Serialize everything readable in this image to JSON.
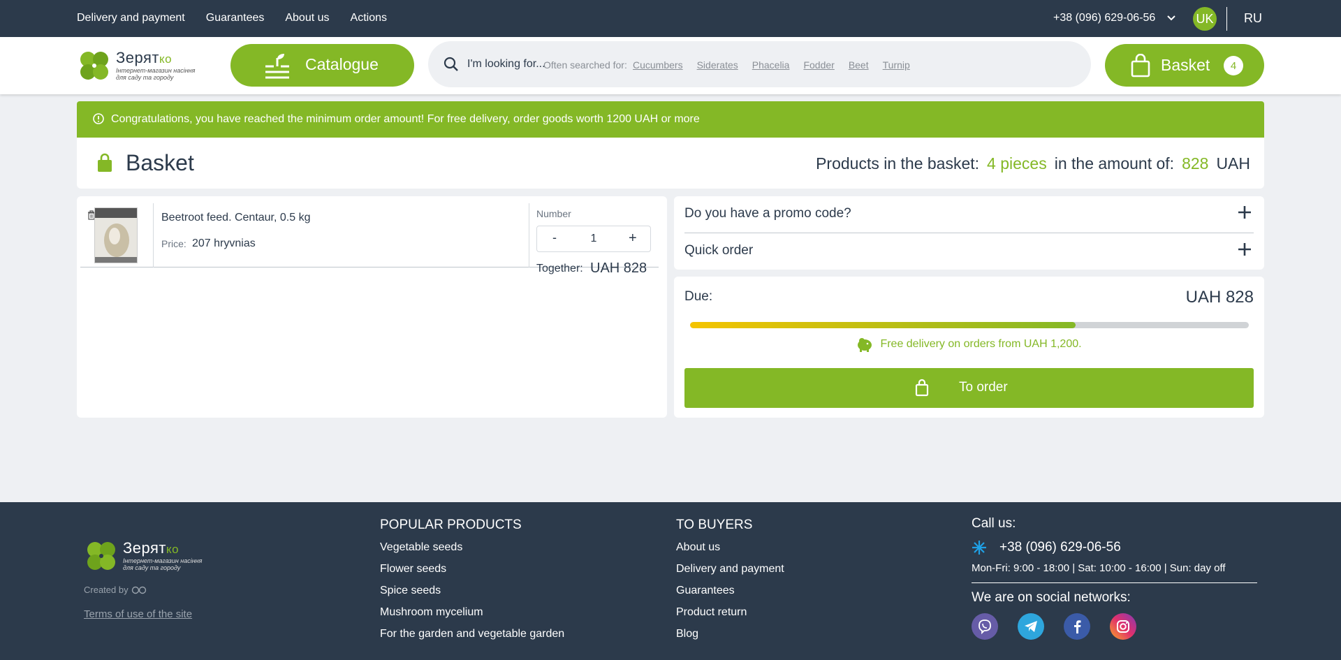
{
  "topnav": {
    "links": [
      "Delivery and payment",
      "Guarantees",
      "About us",
      "Actions"
    ],
    "phone": "+38 (096) 629-06-56",
    "lang_active": "UK",
    "lang_other": "RU"
  },
  "header": {
    "logo_name": "Зерят",
    "logo_name_accent": "ко",
    "logo_sub1": "Інтернет-магазин насіння",
    "logo_sub2": "для саду та городу",
    "catalogue_label": "Catalogue",
    "search_placeholder": "I'm looking for...",
    "often_label": "Often searched for:",
    "tags": [
      "Cucumbers",
      "Siderates",
      "Phacelia",
      "Fodder",
      "Beet",
      "Turnip"
    ],
    "basket_label": "Basket",
    "basket_count": "4"
  },
  "notice": "Congratulations, you have reached the minimum order amount! For free delivery, order goods worth 1200 UAH or more",
  "basket": {
    "title": "Basket",
    "summary_label": "Products in the basket:",
    "summary_pieces": "4 pieces",
    "summary_amount_label": "in the amount of:",
    "summary_amount": "828",
    "summary_currency": "UAH"
  },
  "item": {
    "name": "Beetroot feed. Centaur, 0.5 kg",
    "price_label": "Price:",
    "price_value": "207 hryvnias",
    "number_label": "Number",
    "minus": "-",
    "qty": "1",
    "plus": "+",
    "together_label": "Together:",
    "together_value": "UAH 828"
  },
  "side": {
    "promo_label": "Do you have a promo code?",
    "quick_label": "Quick order",
    "due_label": "Due:",
    "due_value": "UAH 828",
    "progress_fraction": 0.69,
    "free_text": "Free delivery on orders from UAH 1,200.",
    "order_label": "To order"
  },
  "footer": {
    "created_label": "Created by",
    "terms": "Terms of use of the site",
    "popular_title": "POPULAR PRODUCTS",
    "popular": [
      "Vegetable seeds",
      "Flower seeds",
      "Spice seeds",
      "Mushroom mycelium",
      "For the garden and vegetable garden"
    ],
    "buyers_title": "TO BUYERS",
    "buyers": [
      "About us",
      "Delivery and payment",
      "Guarantees",
      "Product return",
      "Blog"
    ],
    "call_label": "Call us:",
    "phone": "+38 (096) 629-06-56",
    "hours": "Mon-Fri: 9:00 - 18:00 | Sat: 10:00 - 16:00 | Sun: day off",
    "social_label": "We are on social networks:",
    "socials": [
      "viber-icon",
      "telegram-icon",
      "facebook-icon",
      "instagram-icon"
    ]
  },
  "colors": {
    "accent": "#84b826",
    "dark": "#2c3a4b",
    "bg": "#eef0f3"
  }
}
